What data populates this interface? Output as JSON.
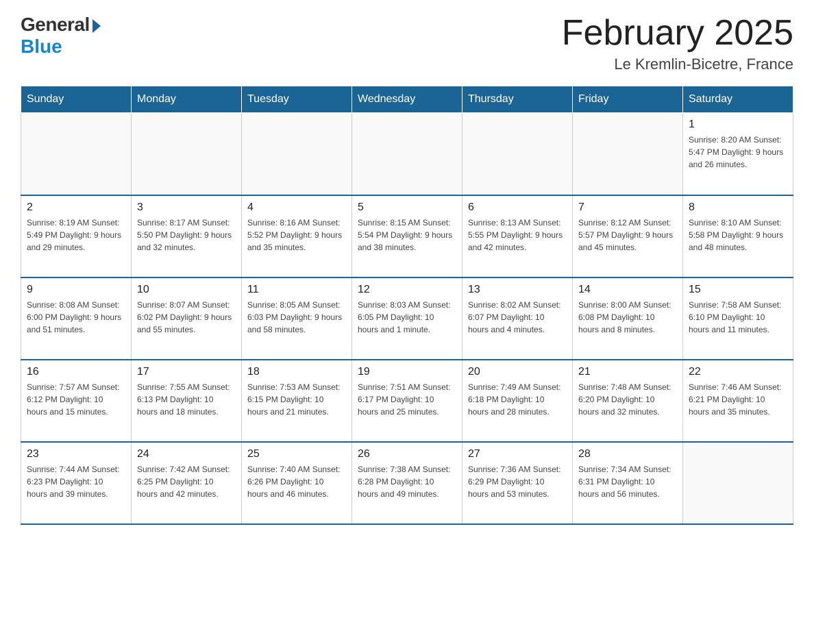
{
  "logo": {
    "general": "General",
    "blue": "Blue"
  },
  "title": "February 2025",
  "subtitle": "Le Kremlin-Bicetre, France",
  "weekdays": [
    "Sunday",
    "Monday",
    "Tuesday",
    "Wednesday",
    "Thursday",
    "Friday",
    "Saturday"
  ],
  "weeks": [
    [
      {
        "day": "",
        "info": ""
      },
      {
        "day": "",
        "info": ""
      },
      {
        "day": "",
        "info": ""
      },
      {
        "day": "",
        "info": ""
      },
      {
        "day": "",
        "info": ""
      },
      {
        "day": "",
        "info": ""
      },
      {
        "day": "1",
        "info": "Sunrise: 8:20 AM\nSunset: 5:47 PM\nDaylight: 9 hours and 26 minutes."
      }
    ],
    [
      {
        "day": "2",
        "info": "Sunrise: 8:19 AM\nSunset: 5:49 PM\nDaylight: 9 hours and 29 minutes."
      },
      {
        "day": "3",
        "info": "Sunrise: 8:17 AM\nSunset: 5:50 PM\nDaylight: 9 hours and 32 minutes."
      },
      {
        "day": "4",
        "info": "Sunrise: 8:16 AM\nSunset: 5:52 PM\nDaylight: 9 hours and 35 minutes."
      },
      {
        "day": "5",
        "info": "Sunrise: 8:15 AM\nSunset: 5:54 PM\nDaylight: 9 hours and 38 minutes."
      },
      {
        "day": "6",
        "info": "Sunrise: 8:13 AM\nSunset: 5:55 PM\nDaylight: 9 hours and 42 minutes."
      },
      {
        "day": "7",
        "info": "Sunrise: 8:12 AM\nSunset: 5:57 PM\nDaylight: 9 hours and 45 minutes."
      },
      {
        "day": "8",
        "info": "Sunrise: 8:10 AM\nSunset: 5:58 PM\nDaylight: 9 hours and 48 minutes."
      }
    ],
    [
      {
        "day": "9",
        "info": "Sunrise: 8:08 AM\nSunset: 6:00 PM\nDaylight: 9 hours and 51 minutes."
      },
      {
        "day": "10",
        "info": "Sunrise: 8:07 AM\nSunset: 6:02 PM\nDaylight: 9 hours and 55 minutes."
      },
      {
        "day": "11",
        "info": "Sunrise: 8:05 AM\nSunset: 6:03 PM\nDaylight: 9 hours and 58 minutes."
      },
      {
        "day": "12",
        "info": "Sunrise: 8:03 AM\nSunset: 6:05 PM\nDaylight: 10 hours and 1 minute."
      },
      {
        "day": "13",
        "info": "Sunrise: 8:02 AM\nSunset: 6:07 PM\nDaylight: 10 hours and 4 minutes."
      },
      {
        "day": "14",
        "info": "Sunrise: 8:00 AM\nSunset: 6:08 PM\nDaylight: 10 hours and 8 minutes."
      },
      {
        "day": "15",
        "info": "Sunrise: 7:58 AM\nSunset: 6:10 PM\nDaylight: 10 hours and 11 minutes."
      }
    ],
    [
      {
        "day": "16",
        "info": "Sunrise: 7:57 AM\nSunset: 6:12 PM\nDaylight: 10 hours and 15 minutes."
      },
      {
        "day": "17",
        "info": "Sunrise: 7:55 AM\nSunset: 6:13 PM\nDaylight: 10 hours and 18 minutes."
      },
      {
        "day": "18",
        "info": "Sunrise: 7:53 AM\nSunset: 6:15 PM\nDaylight: 10 hours and 21 minutes."
      },
      {
        "day": "19",
        "info": "Sunrise: 7:51 AM\nSunset: 6:17 PM\nDaylight: 10 hours and 25 minutes."
      },
      {
        "day": "20",
        "info": "Sunrise: 7:49 AM\nSunset: 6:18 PM\nDaylight: 10 hours and 28 minutes."
      },
      {
        "day": "21",
        "info": "Sunrise: 7:48 AM\nSunset: 6:20 PM\nDaylight: 10 hours and 32 minutes."
      },
      {
        "day": "22",
        "info": "Sunrise: 7:46 AM\nSunset: 6:21 PM\nDaylight: 10 hours and 35 minutes."
      }
    ],
    [
      {
        "day": "23",
        "info": "Sunrise: 7:44 AM\nSunset: 6:23 PM\nDaylight: 10 hours and 39 minutes."
      },
      {
        "day": "24",
        "info": "Sunrise: 7:42 AM\nSunset: 6:25 PM\nDaylight: 10 hours and 42 minutes."
      },
      {
        "day": "25",
        "info": "Sunrise: 7:40 AM\nSunset: 6:26 PM\nDaylight: 10 hours and 46 minutes."
      },
      {
        "day": "26",
        "info": "Sunrise: 7:38 AM\nSunset: 6:28 PM\nDaylight: 10 hours and 49 minutes."
      },
      {
        "day": "27",
        "info": "Sunrise: 7:36 AM\nSunset: 6:29 PM\nDaylight: 10 hours and 53 minutes."
      },
      {
        "day": "28",
        "info": "Sunrise: 7:34 AM\nSunset: 6:31 PM\nDaylight: 10 hours and 56 minutes."
      },
      {
        "day": "",
        "info": ""
      }
    ]
  ]
}
